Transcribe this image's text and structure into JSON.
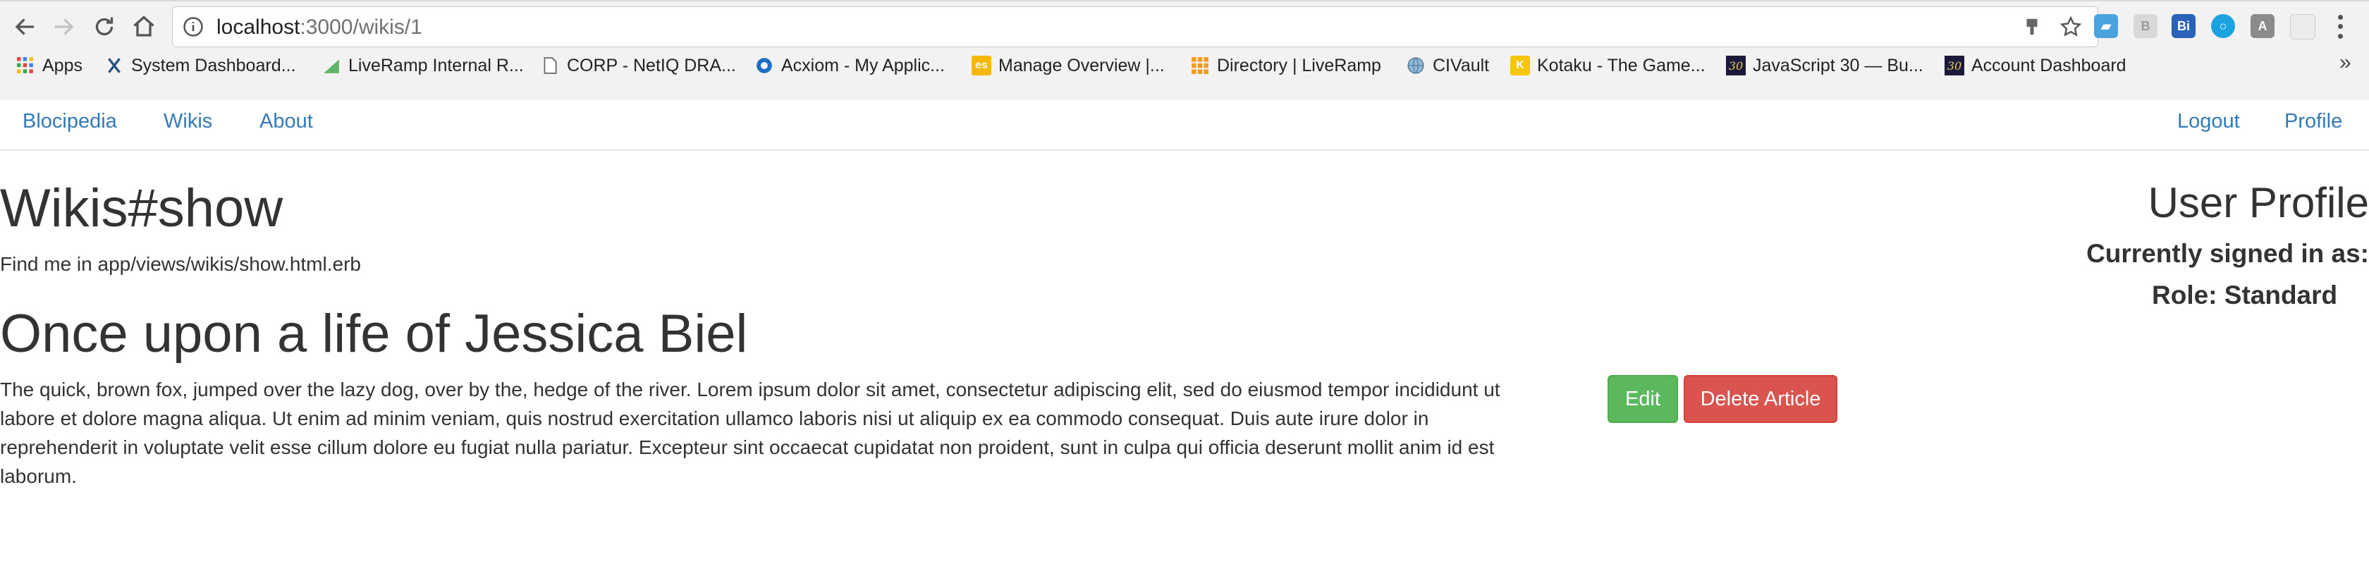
{
  "browser": {
    "url_host": "localhost",
    "url_path": ":3000/wikis/1",
    "bookmarks": [
      {
        "label": "Apps",
        "icon": "apps-grid-icon"
      },
      {
        "label": "System Dashboard...",
        "icon": "jira-icon"
      },
      {
        "label": "LiveRamp Internal R...",
        "icon": "liveramp-icon"
      },
      {
        "label": "CORP - NetIQ DRA...",
        "icon": "document-icon"
      },
      {
        "label": "Acxiom - My Applic...",
        "icon": "acxiom-icon"
      },
      {
        "label": "Manage Overview |...",
        "icon": "es-icon"
      },
      {
        "label": "Directory | LiveRamp",
        "icon": "directory-icon"
      },
      {
        "label": "CIVault",
        "icon": "globe-icon"
      },
      {
        "label": "Kotaku - The Game...",
        "icon": "kotaku-icon"
      },
      {
        "label": "JavaScript 30 — Bu...",
        "icon": "js30-icon"
      },
      {
        "label": "Account Dashboard",
        "icon": "js30-icon"
      }
    ]
  },
  "nav": {
    "brand": "Blocipedia",
    "wikis": "Wikis",
    "about": "About",
    "logout": "Logout",
    "profile": "Profile"
  },
  "page": {
    "heading": "Wikis#show",
    "find_me": "Find me in app/views/wikis/show.html.erb"
  },
  "wiki": {
    "title": "Once upon a life of Jessica Biel",
    "body": "The quick, brown fox, jumped over the lazy dog, over by the, hedge of the river. Lorem ipsum dolor sit amet, consectetur adipiscing elit, sed do eiusmod tempor incididunt ut labore et dolore magna aliqua. Ut enim ad minim veniam, quis nostrud exercitation ullamco laboris nisi ut aliquip ex ea commodo consequat. Duis aute irure dolor in reprehenderit in voluptate velit esse cillum dolore eu fugiat nulla pariatur. Excepteur sint occaecat cupidatat non proident, sunt in culpa qui officia deserunt mollit anim id est laborum.",
    "edit_label": "Edit",
    "delete_label": "Delete Article"
  },
  "user_profile": {
    "title": "User Profile",
    "signed_in": "Currently signed in as:",
    "role": "Role: Standard"
  },
  "colors": {
    "link": "#337ab7",
    "edit_button": "#5cb85c",
    "delete_button": "#d9534f"
  }
}
